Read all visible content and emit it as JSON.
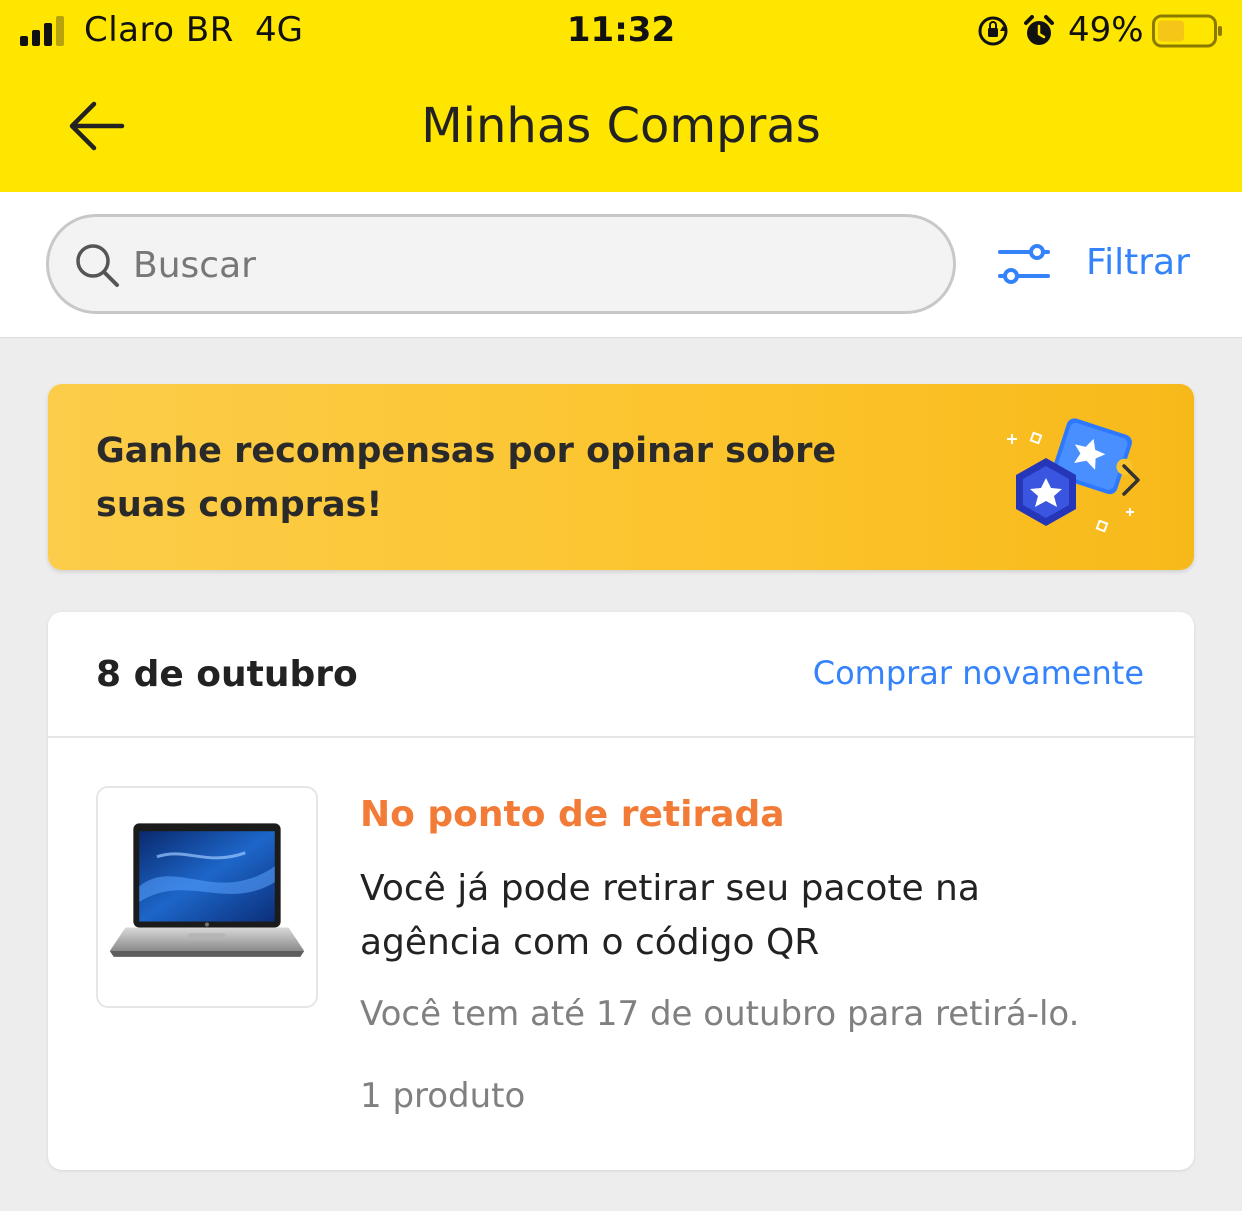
{
  "status_bar": {
    "carrier": "Claro BR",
    "network": "4G",
    "time": "11:32",
    "battery_pct": "49%",
    "battery_level": 0.49,
    "icons": [
      "signal-icon",
      "orientation-lock-icon",
      "alarm-icon",
      "battery-icon"
    ]
  },
  "header": {
    "title": "Minhas Compras",
    "back_icon": "arrow-left-icon",
    "bg_color": "#ffe600"
  },
  "search": {
    "placeholder": "Buscar",
    "icon": "search-icon",
    "filter_label": "Filtrar",
    "filter_icon": "sliders-icon"
  },
  "banner": {
    "text": "Ganhe recompensas por opinar sobre suas compras!",
    "icon": "reward-badges-icon",
    "chevron_icon": "chevron-right-icon"
  },
  "purchase": {
    "date": "8 de outubro",
    "rebuy_label": "Comprar novamente",
    "status_title": "No ponto de retirada",
    "description": "Você já pode retirar seu pacote na agência com o código QR",
    "deadline": "Você tem até 17 de outubro para retirá-lo.",
    "quantity": "1 produto",
    "thumbnail": "laptop-image"
  },
  "colors": {
    "accent": "#3483fa",
    "status": "#f27c37",
    "banner": "#fcc42c"
  }
}
